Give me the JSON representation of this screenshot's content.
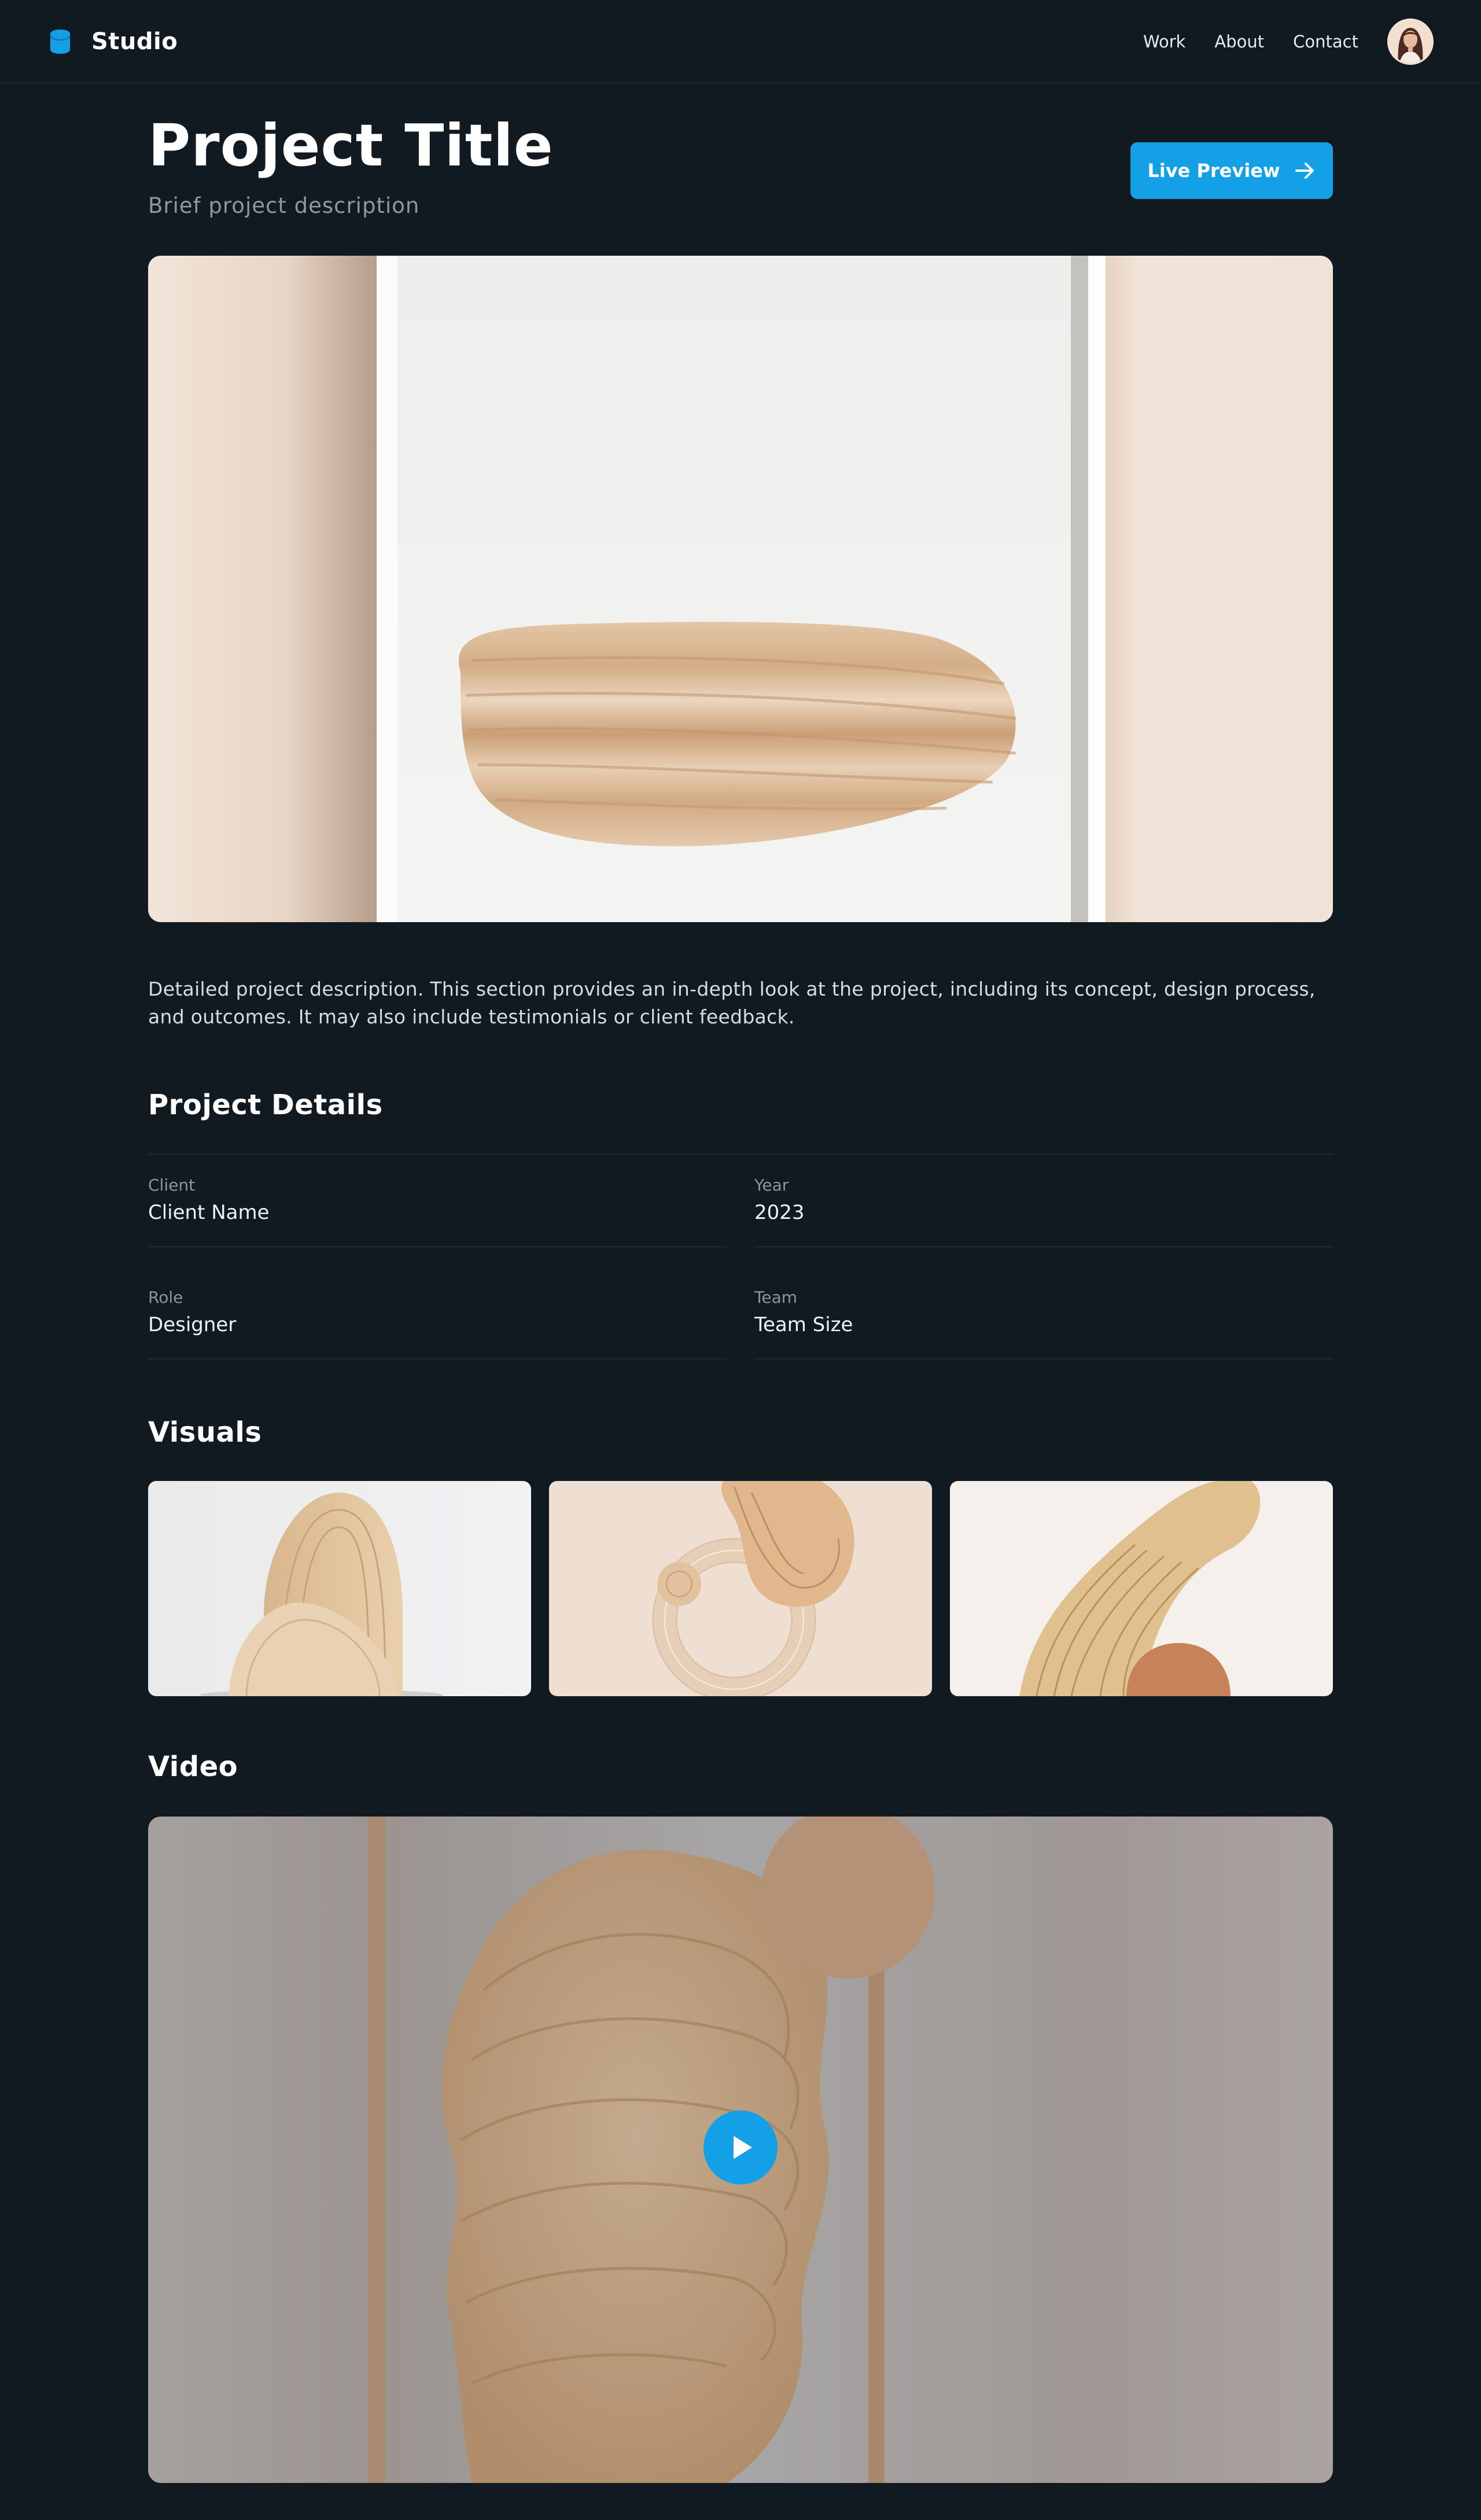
{
  "header": {
    "brand_name": "Studio",
    "nav": [
      "Work",
      "About",
      "Contact"
    ]
  },
  "hero": {
    "title": "Project Title",
    "subtitle": "Brief project description",
    "cta_label": "Live Preview"
  },
  "description": "Detailed project description. This section provides an in-depth look at the project, including its concept, design process, and outcomes. It may also include testimonials or client feedback.",
  "details": {
    "heading": "Project Details",
    "items": [
      {
        "label": "Client",
        "value": "Client Name"
      },
      {
        "label": "Year",
        "value": "2023"
      },
      {
        "label": "Role",
        "value": "Designer"
      },
      {
        "label": "Team",
        "value": "Team Size"
      }
    ]
  },
  "visuals": {
    "heading": "Visuals"
  },
  "video": {
    "heading": "Video"
  },
  "colors": {
    "background": "#111a21",
    "accent": "#14a0e6",
    "muted_text": "#8d98a2",
    "divider": "#1e2a33"
  },
  "icons": {
    "brand": "database-icon",
    "cta": "arrow-right-icon",
    "video": "play-icon"
  }
}
